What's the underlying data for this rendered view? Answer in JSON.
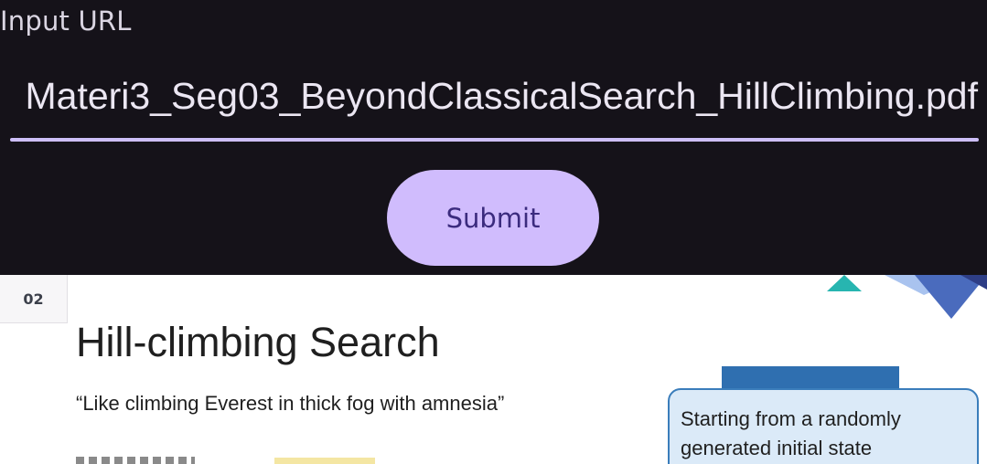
{
  "form": {
    "label": "Input URL",
    "url_value": "Materi3_Seg03_BeyondClassicalSearch_HillClimbing.pdf",
    "submit_label": "Submit"
  },
  "slide": {
    "page_number": "02",
    "title": "Hill-climbing Search",
    "quote": "“Like climbing Everest in thick fog with amnesia”",
    "callout_lines": [
      "Starting from a randomly",
      "generated initial state"
    ]
  },
  "colors": {
    "app_background": "#151219",
    "accent": "#d0bcfd",
    "button_text": "#3b2b7e",
    "callout_fill": "#dbeaf8",
    "callout_border": "#3a7dbb"
  }
}
